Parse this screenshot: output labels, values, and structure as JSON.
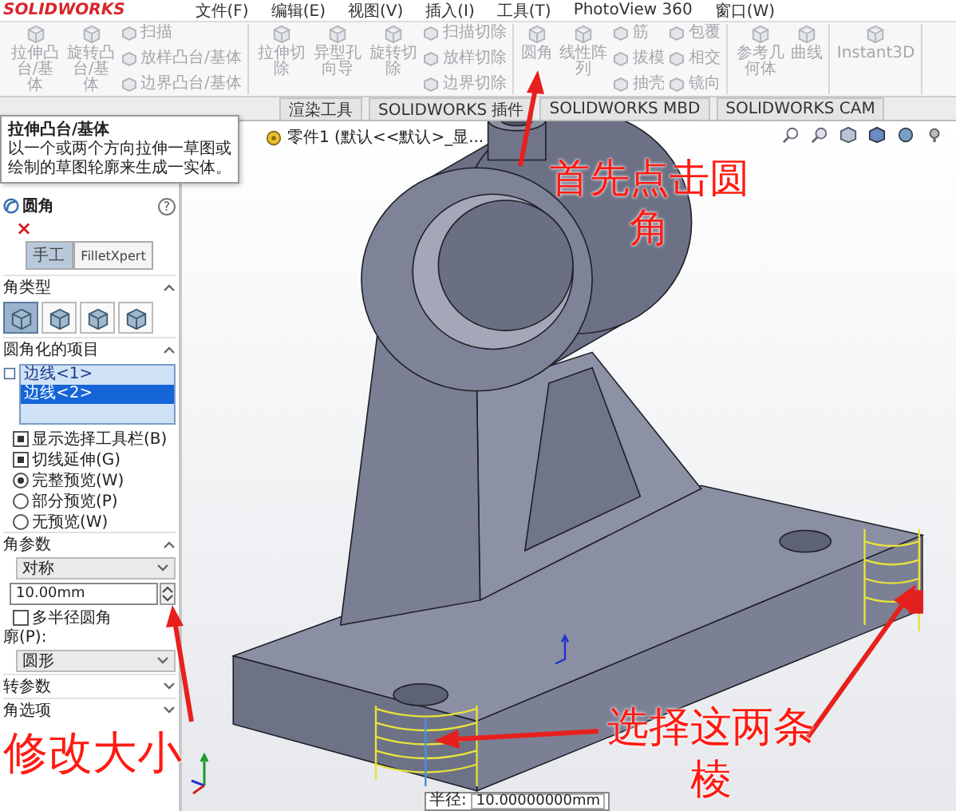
{
  "app": {
    "logo": "SOLIDWORKS"
  },
  "menu": [
    "文件(F)",
    "编辑(E)",
    "视图(V)",
    "插入(I)",
    "工具(T)",
    "PhotoView 360",
    "窗口(W)"
  ],
  "ribbon": [
    [
      {
        "kind": "large",
        "label": "拉伸凸台/基体"
      },
      {
        "kind": "large",
        "label": "旋转凸台/基体"
      },
      {
        "kind": "stack",
        "items": [
          "扫描",
          "放样凸台/基体",
          "边界凸台/基体"
        ]
      }
    ],
    [
      {
        "kind": "large",
        "label": "拉伸切除"
      },
      {
        "kind": "large",
        "label": "异型孔向导"
      },
      {
        "kind": "large",
        "label": "旋转切除"
      },
      {
        "kind": "stack",
        "items": [
          "扫描切除",
          "放样切除",
          "边界切除"
        ]
      }
    ],
    [
      {
        "kind": "large",
        "label": "圆角"
      },
      {
        "kind": "large",
        "label": "线性阵列"
      },
      {
        "kind": "stack",
        "items": [
          "筋",
          "拔模",
          "抽壳"
        ]
      },
      {
        "kind": "stack",
        "items": [
          "包覆",
          "相交",
          "镜向"
        ]
      }
    ],
    [
      {
        "kind": "large",
        "label": "参考几何体"
      },
      {
        "kind": "large",
        "label": "曲线"
      }
    ],
    [
      {
        "kind": "large",
        "label": "Instant3D"
      }
    ]
  ],
  "tabs": [
    {
      "label": "渲染工具",
      "selected": false
    },
    {
      "label": "SOLIDWORKS 插件",
      "selected": false
    },
    {
      "label": "SOLIDWORKS MBD",
      "selected": false
    },
    {
      "label": "SOLIDWORKS CAM",
      "selected": false
    }
  ],
  "tooltip": {
    "title": "拉伸凸台/基体",
    "text": "以一个或两个方向拉伸一草图或绘制的草图轮廓来生成一实体。"
  },
  "panel": {
    "title": "圆角",
    "help": "?",
    "close": "×",
    "modes": [
      {
        "label": "手工",
        "selected": true
      },
      {
        "label": "FilletXpert",
        "selected": false
      }
    ],
    "fillet_type": {
      "heading": "角类型",
      "types": [
        {
          "selected": true
        },
        {
          "selected": false
        },
        {
          "selected": false
        },
        {
          "selected": false
        }
      ]
    },
    "items": {
      "heading": "圆角化的项目",
      "entries": [
        {
          "label": "边线<1>",
          "selected": false
        },
        {
          "label": "边线<2>",
          "selected": true
        }
      ]
    },
    "options": [
      {
        "kind": "checkbox",
        "label": "显示选择工具栏(B)",
        "checked": true
      },
      {
        "kind": "checkbox",
        "label": "切线延伸(G)",
        "checked": true
      },
      {
        "kind": "radio",
        "label": "完整预览(W)",
        "selected": true
      },
      {
        "kind": "radio",
        "label": "部分预览(P)",
        "selected": false
      },
      {
        "kind": "radio",
        "label": "无预览(W)",
        "selected": false
      }
    ],
    "parameters": {
      "heading": "角参数",
      "method": "对称",
      "radius": "10.00mm",
      "multi_radius": {
        "label": "多半径圆角",
        "checked": false
      },
      "profile_label": "廓(P):",
      "profile": "圆形"
    },
    "collapsed_sections": [
      "转参数",
      "角选项"
    ]
  },
  "viewport": {
    "document_title": "零件1 (默认<<默认>_显...",
    "dimension": {
      "label": "半径:",
      "value": "10.00000000mm"
    }
  },
  "annotations": [
    {
      "text": "首先点击圆角"
    },
    {
      "text": "修改大小"
    },
    {
      "text": "选择这两条棱"
    }
  ]
}
